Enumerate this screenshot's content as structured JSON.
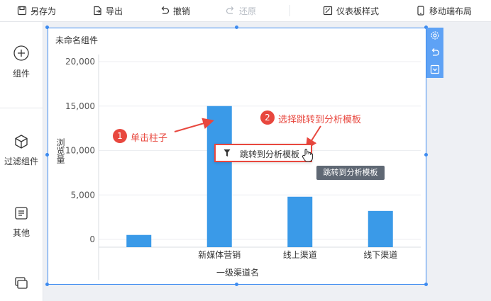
{
  "toolbar": {
    "save_as": "另存为",
    "export": "导出",
    "undo": "撤销",
    "redo": "还原",
    "dashboard_style": "仪表板样式",
    "mobile_layout": "移动端布局"
  },
  "sidebar": {
    "items": [
      {
        "label": "组件",
        "icon": "plus-circle-icon"
      },
      {
        "label": "过滤组件",
        "icon": "cube-icon"
      },
      {
        "label": "其他",
        "icon": "document-icon"
      },
      {
        "label": "",
        "icon": "layers-icon"
      }
    ]
  },
  "widget": {
    "title": "未命名组件"
  },
  "popup": {
    "menu_item": "跳转到分析模板"
  },
  "tooltip": {
    "text": "跳转到分析模板"
  },
  "annotations": [
    {
      "number": "1",
      "text": "单击柱子"
    },
    {
      "number": "2",
      "text": "选择跳转到分析模板"
    }
  ],
  "colors": {
    "bar": "#3a9ae8",
    "selection": "#3d8bf0",
    "annotation": "#e8473e"
  },
  "chart_data": {
    "type": "bar",
    "categories": [
      "",
      "新媒体营销",
      "线上渠道",
      "线下渠道"
    ],
    "values": [
      500,
      15000,
      4800,
      3200
    ],
    "xlabel": "一级渠道名",
    "ylabel": "浏览量",
    "ylim": [
      0,
      20000
    ],
    "yticks": [
      0,
      5000,
      10000,
      15000,
      20000
    ],
    "ytick_labels": [
      "0",
      "5,000",
      "10,000",
      "15,000",
      "20,000"
    ],
    "grid": true
  }
}
